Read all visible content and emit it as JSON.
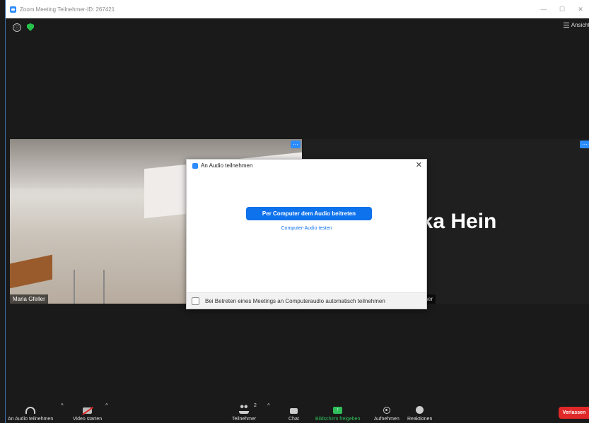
{
  "window": {
    "title": "Zoom Meeting Teilnehmer-ID: 267421",
    "minimize": "—",
    "maximize": "☐",
    "close": "✕"
  },
  "header": {
    "info_icon": "ⓘ",
    "view_label": "Ansicht"
  },
  "participants": {
    "left_name": "Maria Gfeller",
    "right_display_name": "nika Hein",
    "right_status": "osignal her",
    "more_glyph": "···"
  },
  "dialog": {
    "title": "An Audio teilnehmen",
    "close": "✕",
    "join_button": "Per Computer dem Audio beitreten",
    "test_link": "Computer-Audio testen",
    "auto_join_label": "Bei Betreten eines Meetings an Computeraudio automatisch teilnehmen",
    "auto_join_checked": false
  },
  "toolbar": {
    "audio": "An Audio teilnehmen",
    "video": "Video starten",
    "participants": "Teilnehmer",
    "participants_count": "2",
    "chat": "Chat",
    "share": "Bildschirm freigeben",
    "share_icon": "↑",
    "record": "Aufnehmen",
    "reactions": "Reaktionen",
    "leave": "Verlassen",
    "caret": "^"
  },
  "colors": {
    "accent": "#0e72ed",
    "share_green": "#2fbf5a",
    "leave_red": "#e02828"
  }
}
